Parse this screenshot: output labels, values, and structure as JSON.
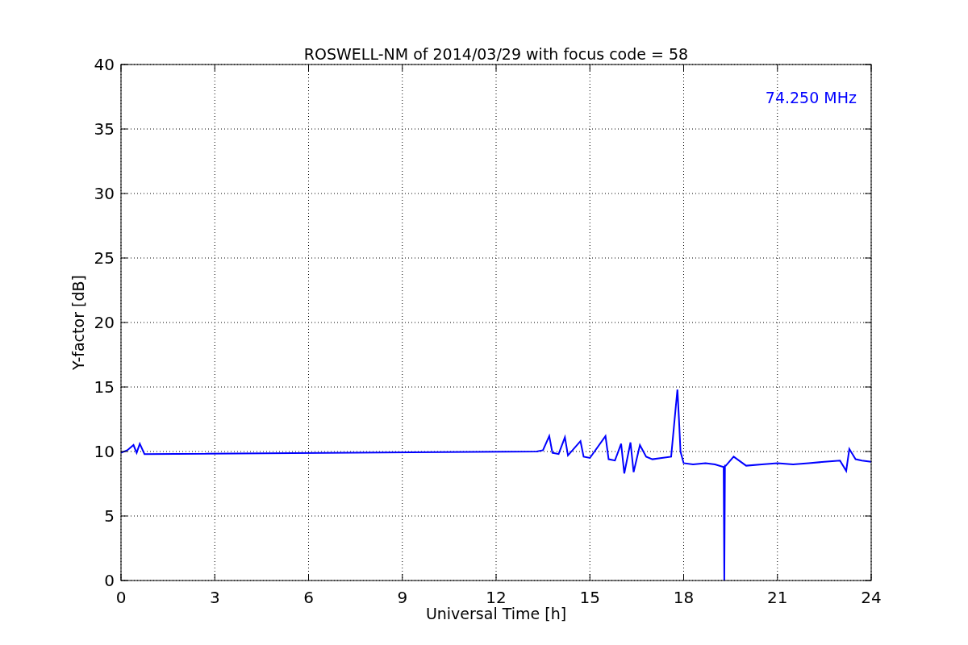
{
  "chart_data": {
    "type": "line",
    "title": "ROSWELL-NM of 2014/03/29 with focus code = 58",
    "xlabel": "Universal Time [h]",
    "ylabel": "Y-factor [dB]",
    "x": [
      0,
      0.2,
      0.4,
      0.5,
      0.6,
      0.75,
      13.3,
      13.5,
      13.7,
      13.8,
      14.0,
      14.2,
      14.3,
      14.7,
      14.8,
      15.0,
      15.5,
      15.6,
      15.8,
      16.0,
      16.1,
      16.3,
      16.4,
      16.6,
      16.8,
      17.0,
      17.3,
      17.6,
      17.75,
      17.8,
      17.85,
      17.9,
      18.0,
      18.3,
      18.7,
      19.0,
      19.28,
      19.3,
      19.32,
      19.35,
      19.6,
      20.0,
      20.5,
      21.0,
      21.5,
      22.0,
      22.5,
      23.0,
      23.2,
      23.3,
      23.5,
      23.7,
      24.0
    ],
    "series": [
      {
        "name": "74.250 MHz",
        "color": "#0000ff",
        "values": [
          9.9,
          10.1,
          10.5,
          9.9,
          10.6,
          9.8,
          10.0,
          10.1,
          11.2,
          9.9,
          9.8,
          11.1,
          9.7,
          10.8,
          9.6,
          9.5,
          11.2,
          9.4,
          9.3,
          10.6,
          8.3,
          10.7,
          8.4,
          10.5,
          9.6,
          9.4,
          9.5,
          9.6,
          13.5,
          14.8,
          12.5,
          10.0,
          9.1,
          9.0,
          9.1,
          9.0,
          8.8,
          0.0,
          8.9,
          8.9,
          9.6,
          8.9,
          9.0,
          9.1,
          9.0,
          9.1,
          9.2,
          9.3,
          8.5,
          10.2,
          9.4,
          9.3,
          9.2
        ]
      }
    ],
    "xlim": [
      0,
      24
    ],
    "ylim": [
      0,
      40
    ],
    "xticks": [
      0,
      3,
      6,
      9,
      12,
      15,
      18,
      21,
      24
    ],
    "yticks": [
      0,
      5,
      10,
      15,
      20,
      25,
      30,
      35,
      40
    ],
    "grid": true
  }
}
